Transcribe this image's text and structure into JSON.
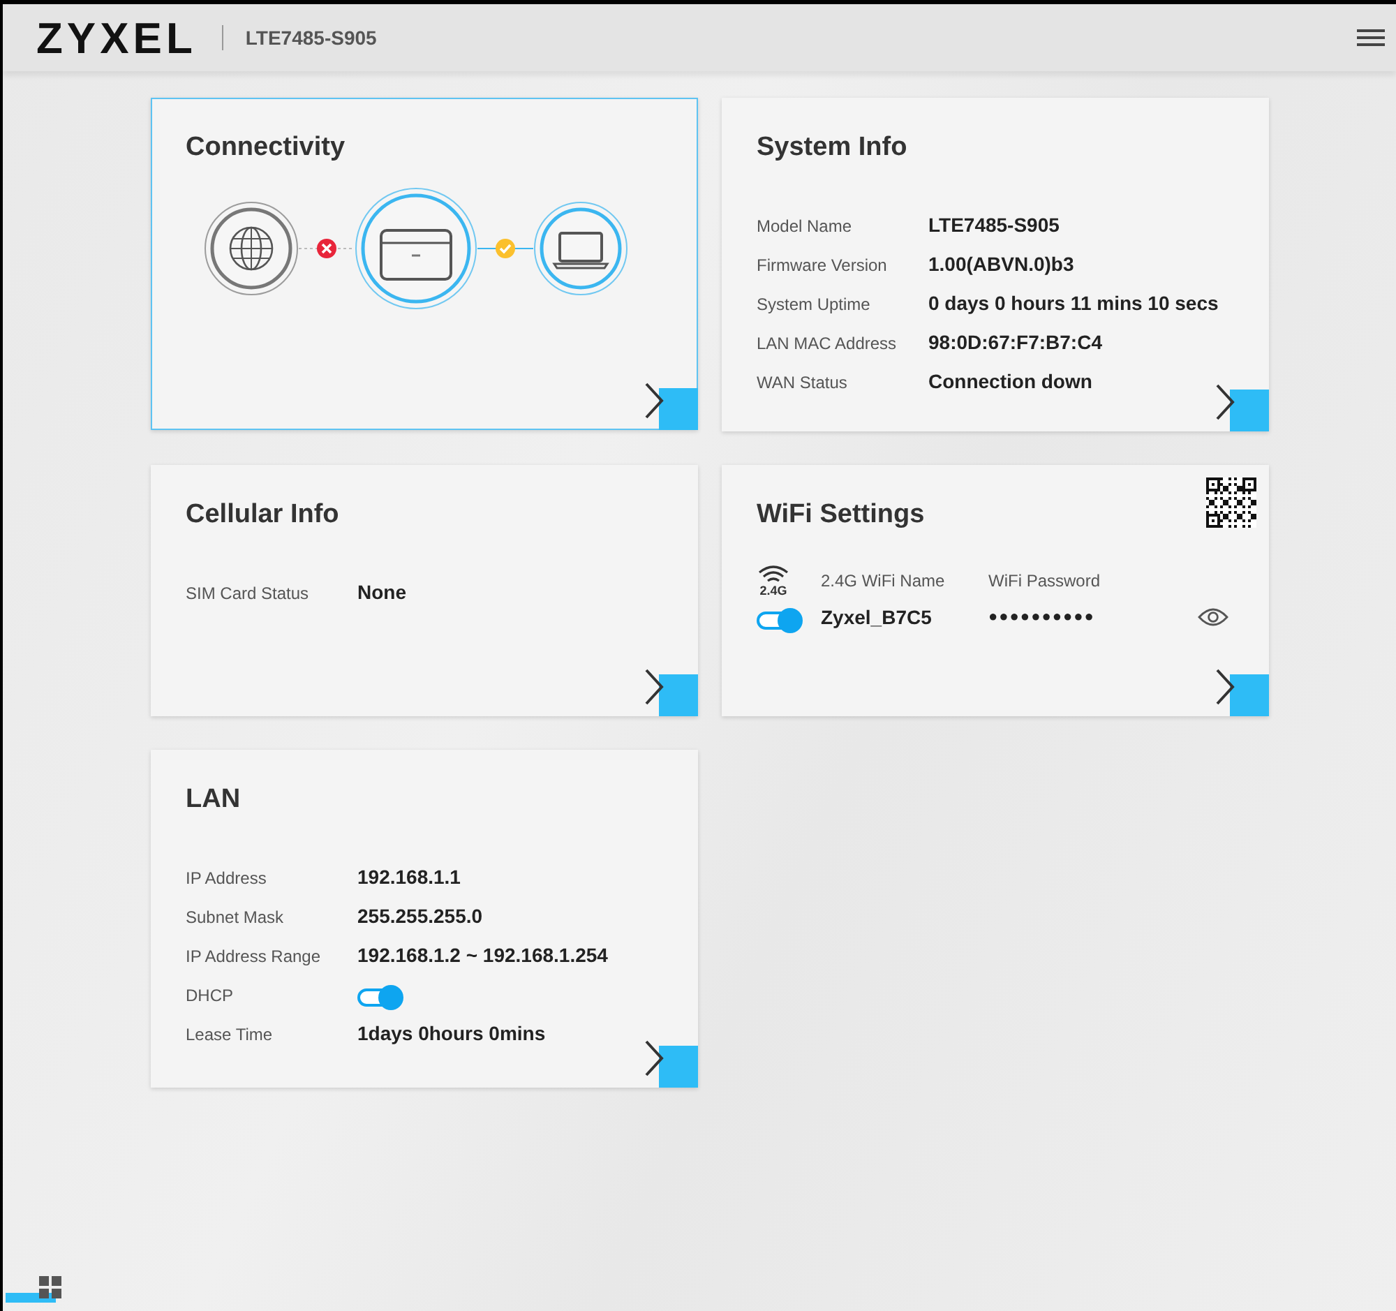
{
  "header": {
    "logo": "ZYXEL",
    "model": "LTE7485-S905"
  },
  "cards": [
    {
      "kind": "connectivity",
      "title": "Connectivity",
      "selected": true,
      "wan_connected": false,
      "lan_connected": true
    },
    {
      "kind": "info",
      "title": "System Info",
      "selected": false,
      "rows": [
        {
          "label": "Model Name",
          "value": "LTE7485-S905"
        },
        {
          "label": "Firmware Version",
          "value": "1.00(ABVN.0)b3"
        },
        {
          "label": "System Uptime",
          "value": "0 days 0 hours 11 mins 10 secs"
        },
        {
          "label": "LAN MAC Address",
          "value": "98:0D:67:F7:B7:C4"
        },
        {
          "label": "WAN Status",
          "value": "Connection down"
        }
      ]
    },
    {
      "kind": "info",
      "title": "Cellular Info",
      "selected": false,
      "rows": [
        {
          "label": "SIM Card Status",
          "value": "None"
        }
      ]
    },
    {
      "kind": "wifi",
      "title": "WiFi Settings",
      "selected": false,
      "band": "2.4G",
      "name_label": "2.4G WiFi Name",
      "password_label": "WiFi Password",
      "enabled": true,
      "name": "Zyxel_B7C5",
      "password": "●●●●●●●●●●"
    },
    {
      "kind": "info",
      "title": "LAN",
      "selected": false,
      "rows": [
        {
          "label": "IP Address",
          "value": "192.168.1.1"
        },
        {
          "label": "Subnet Mask",
          "value": "255.255.255.0"
        },
        {
          "label": "IP Address Range",
          "value": "192.168.1.2 ~ 192.168.1.254"
        },
        {
          "label": "DHCP",
          "kind": "toggle",
          "on": true
        },
        {
          "label": "Lease Time",
          "value": "1days 0hours 0mins"
        }
      ]
    }
  ]
}
